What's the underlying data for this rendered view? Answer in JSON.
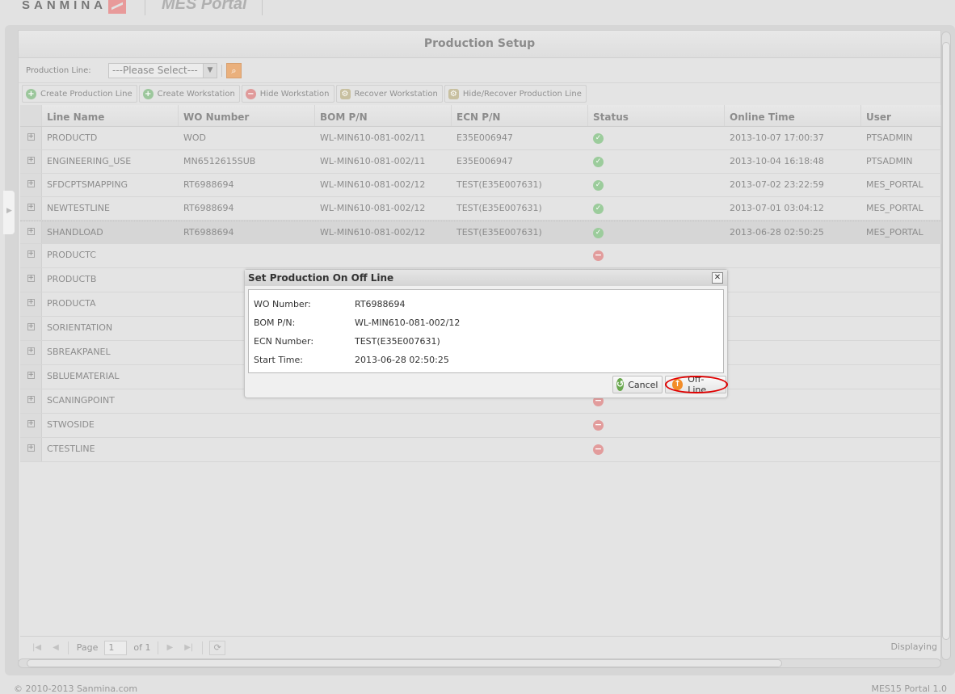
{
  "header": {
    "brand": "SANMINA",
    "portal_name": "MES Portal"
  },
  "panel": {
    "title": "Production Setup"
  },
  "filter": {
    "label": "Production Line:",
    "select_value": "---Please Select---",
    "search_icon": "search-icon"
  },
  "toolbar": {
    "buttons": [
      {
        "label": "Create Production Line",
        "icon": "add-icon"
      },
      {
        "label": "Create Workstation",
        "icon": "add-icon"
      },
      {
        "label": "Hide Workstation",
        "icon": "remove-icon"
      },
      {
        "label": "Recover Workstation",
        "icon": "gear-icon"
      },
      {
        "label": "Hide/Recover Production Line",
        "icon": "gear-icon"
      }
    ]
  },
  "grid": {
    "columns": [
      "Line Name",
      "WO Number",
      "BOM P/N",
      "ECN P/N",
      "Status",
      "Online Time",
      "User"
    ],
    "rows": [
      {
        "line": "PRODUCTD",
        "wo": "WOD",
        "bom": "WL-MIN610-081-002/11",
        "ecn": "E35E006947",
        "status": "online",
        "time": "2013-10-07 17:00:37",
        "user": "PTSADMIN"
      },
      {
        "line": "ENGINEERING_USE",
        "wo": "MN6512615SUB",
        "bom": "WL-MIN610-081-002/11",
        "ecn": "E35E006947",
        "status": "online",
        "time": "2013-10-04 16:18:48",
        "user": "PTSADMIN"
      },
      {
        "line": "SFDCPTSMAPPING",
        "wo": "RT6988694",
        "bom": "WL-MIN610-081-002/12",
        "ecn": "TEST(E35E007631)",
        "status": "online",
        "time": "2013-07-02 23:22:59",
        "user": "MES_PORTAL"
      },
      {
        "line": "NEWTESTLINE",
        "wo": "RT6988694",
        "bom": "WL-MIN610-081-002/12",
        "ecn": "TEST(E35E007631)",
        "status": "online",
        "time": "2013-07-01 03:04:12",
        "user": "MES_PORTAL"
      },
      {
        "line": "SHANDLOAD",
        "wo": "RT6988694",
        "bom": "WL-MIN610-081-002/12",
        "ecn": "TEST(E35E007631)",
        "status": "online",
        "time": "2013-06-28 02:50:25",
        "user": "MES_PORTAL",
        "selected": true
      },
      {
        "line": "PRODUCTC",
        "wo": "",
        "bom": "",
        "ecn": "",
        "status": "offline",
        "time": "",
        "user": ""
      },
      {
        "line": "PRODUCTB",
        "wo": "",
        "bom": "",
        "ecn": "",
        "status": "offline",
        "time": "",
        "user": ""
      },
      {
        "line": "PRODUCTA",
        "wo": "",
        "bom": "",
        "ecn": "",
        "status": "offline",
        "time": "",
        "user": ""
      },
      {
        "line": "SORIENTATION",
        "wo": "",
        "bom": "",
        "ecn": "",
        "status": "offline",
        "time": "",
        "user": ""
      },
      {
        "line": "SBREAKPANEL",
        "wo": "",
        "bom": "",
        "ecn": "",
        "status": "offline",
        "time": "",
        "user": ""
      },
      {
        "line": "SBLUEMATERIAL",
        "wo": "",
        "bom": "",
        "ecn": "",
        "status": "offline",
        "time": "",
        "user": ""
      },
      {
        "line": "SCANINGPOINT",
        "wo": "",
        "bom": "",
        "ecn": "",
        "status": "offline",
        "time": "",
        "user": ""
      },
      {
        "line": "STWOSIDE",
        "wo": "",
        "bom": "",
        "ecn": "",
        "status": "offline",
        "time": "",
        "user": ""
      },
      {
        "line": "CTESTLINE",
        "wo": "",
        "bom": "",
        "ecn": "",
        "status": "offline",
        "time": "",
        "user": ""
      }
    ]
  },
  "pager": {
    "page_label": "Page",
    "page_value": "1",
    "of_label": "of 1",
    "displaying": "Displaying"
  },
  "dialog": {
    "title": "Set Production On Off Line",
    "fields": [
      {
        "label": "WO Number:",
        "value": "RT6988694"
      },
      {
        "label": "BOM P/N:",
        "value": "WL-MIN610-081-002/12"
      },
      {
        "label": "ECN Number:",
        "value": "TEST(E35E007631)"
      },
      {
        "label": "Start Time:",
        "value": "2013-06-28 02:50:25"
      }
    ],
    "cancel_label": "Cancel",
    "offline_label": "Off-Line"
  },
  "footer": {
    "copyright": "© 2010-2013 Sanmina.com",
    "version": "MES15 Portal 1.0"
  },
  "colors": {
    "online": "#9ccc9c",
    "offline": "#e29c9c",
    "highlight_ring": "#e00000",
    "search_button": "#eab07c"
  }
}
